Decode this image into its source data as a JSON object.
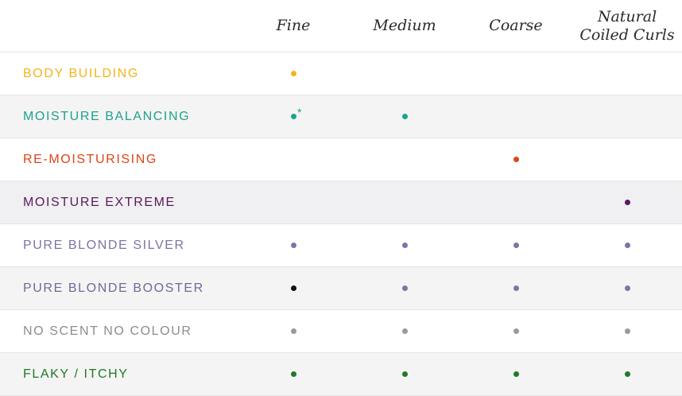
{
  "columns": [
    "Fine",
    "Medium",
    "Coarse",
    "Natural Coiled Curls"
  ],
  "column_lines": {
    "natural_line1": "Natural",
    "natural_line2": "Coiled Curls"
  },
  "rows": [
    {
      "label": "BODY BUILDING",
      "color": "#f2b418",
      "dots": [
        "#f2b418",
        null,
        null,
        null
      ],
      "note": ""
    },
    {
      "label": "MOISTURE BALANCING",
      "color": "#1aa38e",
      "dots": [
        "#1aa38e",
        "#1aa38e",
        null,
        null
      ],
      "note": "*"
    },
    {
      "label": "RE-MOISTURISING",
      "color": "#dd4418",
      "dots": [
        null,
        null,
        "#dd4418",
        null
      ],
      "note": ""
    },
    {
      "label": "MOISTURE EXTREME",
      "color": "#5a1a5e",
      "dots": [
        null,
        null,
        null,
        "#5a1a5e"
      ],
      "note": ""
    },
    {
      "label": "PURE BLONDE SILVER",
      "color": "#7a76a4",
      "dots": [
        "#7a76a4",
        "#7a76a4",
        "#7a76a4",
        "#7a76a4"
      ],
      "note": ""
    },
    {
      "label": "PURE BLONDE BOOSTER",
      "color": "#6d6a99",
      "dots": [
        "#111111",
        "#7a76a4",
        "#7a76a4",
        "#7a76a4"
      ],
      "note": ""
    },
    {
      "label": "NO SCENT NO COLOUR",
      "color": "#8c8c8c",
      "dots": [
        "#9a9a9a",
        "#9a9a9a",
        "#9a9a9a",
        "#9a9a9a"
      ],
      "note": ""
    },
    {
      "label": "FLAKY / ITCHY",
      "color": "#1e7a26",
      "dots": [
        "#1e7a26",
        "#1e7a26",
        "#1e7a26",
        "#1e7a26"
      ],
      "note": ""
    }
  ]
}
